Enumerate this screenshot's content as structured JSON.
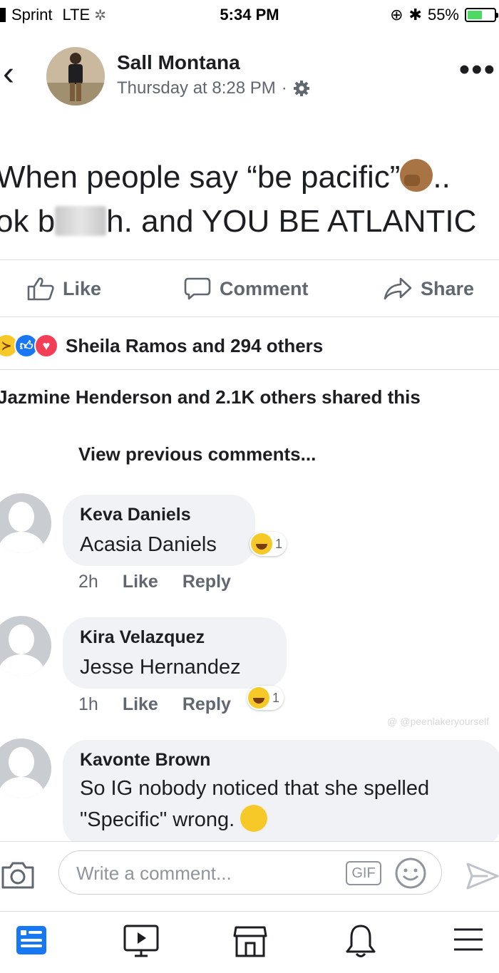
{
  "status_bar": {
    "carrier": "Sprint",
    "network": "LTE",
    "time": "5:34 PM",
    "battery": "55%",
    "battery_level": 0.55
  },
  "post": {
    "author": "Sall Montana",
    "timestamp": "Thursday at 8:28 PM",
    "separator": "·",
    "text_line1": "When people say “be pacific”",
    "text_line1_end": "..",
    "text_line2_start": "ok b",
    "text_line2_end": "h. and YOU BE ATLANTIC"
  },
  "actions": {
    "like": "Like",
    "comment": "Comment",
    "share": "Share"
  },
  "reactions_summary": "Sheila Ramos and 294 others",
  "shares_summary": "Jazmine Henderson and 2.1K others shared this",
  "view_previous": "View previous comments...",
  "comments": [
    {
      "name": "Keva Daniels",
      "text": "Acasia Daniels",
      "time": "2h",
      "like": "Like",
      "reply": "Reply",
      "reaction_count": "1"
    },
    {
      "name": "Kira Velazquez",
      "text": "Jesse Hernandez",
      "time": "1h",
      "like": "Like",
      "reply": "Reply",
      "reaction_count": "1"
    },
    {
      "name": "Kavonte Brown",
      "text_line1": "So IG nobody noticed that she spelled",
      "text_line2": "\"Specific\" wrong."
    }
  ],
  "watermark": "@ @peenlakeryourself",
  "composer": {
    "placeholder": "Write a comment...",
    "gif": "GIF"
  },
  "colors": {
    "text": "#1c1e21",
    "secondary": "#606770",
    "bubble": "#f0f2f5",
    "like_blue": "#1877f2",
    "love_red": "#f33e58",
    "haha_yellow": "#f7c928",
    "battery_green": "#4cd964"
  },
  "icons": [
    "back-chevron-icon",
    "gear-icon",
    "more-icon",
    "like-icon",
    "comment-icon",
    "share-icon",
    "camera-icon",
    "smile-icon",
    "send-icon",
    "news-feed-icon",
    "watch-icon",
    "marketplace-icon",
    "bell-icon",
    "menu-icon"
  ]
}
